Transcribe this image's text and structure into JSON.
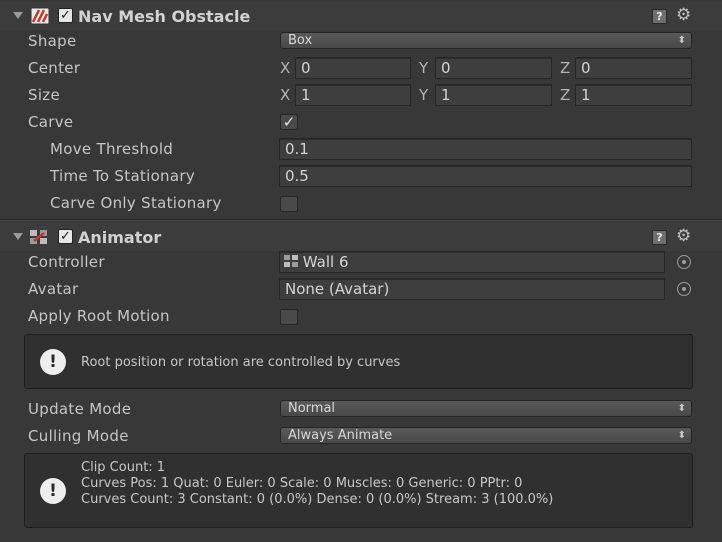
{
  "nav_mesh_obstacle": {
    "title": "Nav Mesh Obstacle",
    "enabled_check": "✓",
    "help_glyph": "?",
    "gear_glyph": "⚙",
    "shape": {
      "label": "Shape",
      "value": "Box"
    },
    "center": {
      "label": "Center",
      "x_axis": "X",
      "x": "0",
      "y_axis": "Y",
      "y": "0",
      "z_axis": "Z",
      "z": "0"
    },
    "size": {
      "label": "Size",
      "x_axis": "X",
      "x": "1",
      "y_axis": "Y",
      "y": "1",
      "z_axis": "Z",
      "z": "1"
    },
    "carve": {
      "label": "Carve",
      "checked": true,
      "check_glyph": "✓"
    },
    "move_threshold": {
      "label": "Move Threshold",
      "value": "0.1"
    },
    "time_to_stationary": {
      "label": "Time To Stationary",
      "value": "0.5"
    },
    "carve_only_stationary": {
      "label": "Carve Only Stationary",
      "checked": false
    }
  },
  "animator": {
    "title": "Animator",
    "enabled_check": "✓",
    "help_glyph": "?",
    "gear_glyph": "⚙",
    "controller": {
      "label": "Controller",
      "value": "Wall 6",
      "icon": "animator-controller-icon"
    },
    "avatar": {
      "label": "Avatar",
      "value": "None (Avatar)"
    },
    "apply_root_motion": {
      "label": "Apply Root Motion",
      "checked": false
    },
    "root_info": {
      "glyph": "!",
      "text": "Root position or rotation are controlled by curves"
    },
    "update_mode": {
      "label": "Update Mode",
      "value": "Normal"
    },
    "culling_mode": {
      "label": "Culling Mode",
      "value": "Always Animate"
    },
    "clip_info": {
      "glyph": "!",
      "line1": "Clip Count: 1",
      "line2": "Curves Pos: 1 Quat: 0 Euler: 0 Scale: 0 Muscles: 0 Generic: 0 PPtr: 0",
      "line3": "Curves Count: 3 Constant: 0 (0.0%) Dense: 0 (0.0%) Stream: 3 (100.0%)"
    }
  },
  "dropdown_arrow": "⬍",
  "colors": {
    "background": "#383838",
    "header": "#3c3c3c",
    "field": "#3e3e3e",
    "text": "#c6c6c6",
    "icon_red": "#c0392b"
  }
}
